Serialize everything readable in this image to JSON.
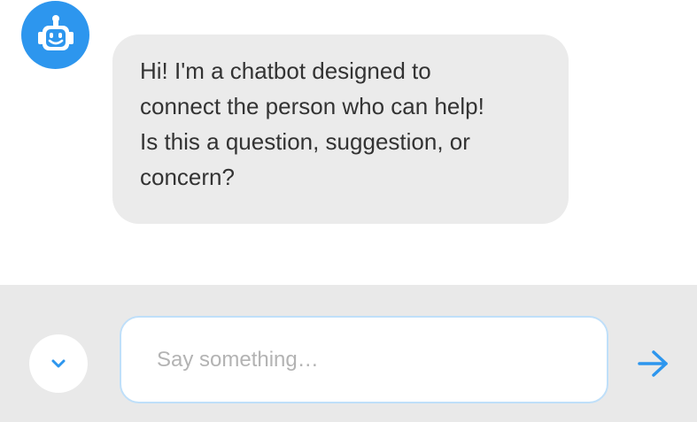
{
  "colors": {
    "accent": "#2d96ee",
    "bubble_bg": "#ebebeb",
    "composer_bg": "#e9e9e9",
    "text": "#333333",
    "placeholder": "#b3b3b3",
    "input_border": "#bfdff9"
  },
  "chat": {
    "avatar_icon": "robot-face-icon",
    "messages": [
      {
        "sender": "bot",
        "text": "Hi! I'm a chatbot designed to\nconnect the person who can help!\nIs this a question, suggestion, or\nconcern?"
      }
    ]
  },
  "composer": {
    "scroll_icon": "chevron-down-icon",
    "input_value": "",
    "input_placeholder": "Say something…",
    "send_icon": "arrow-right-icon"
  }
}
